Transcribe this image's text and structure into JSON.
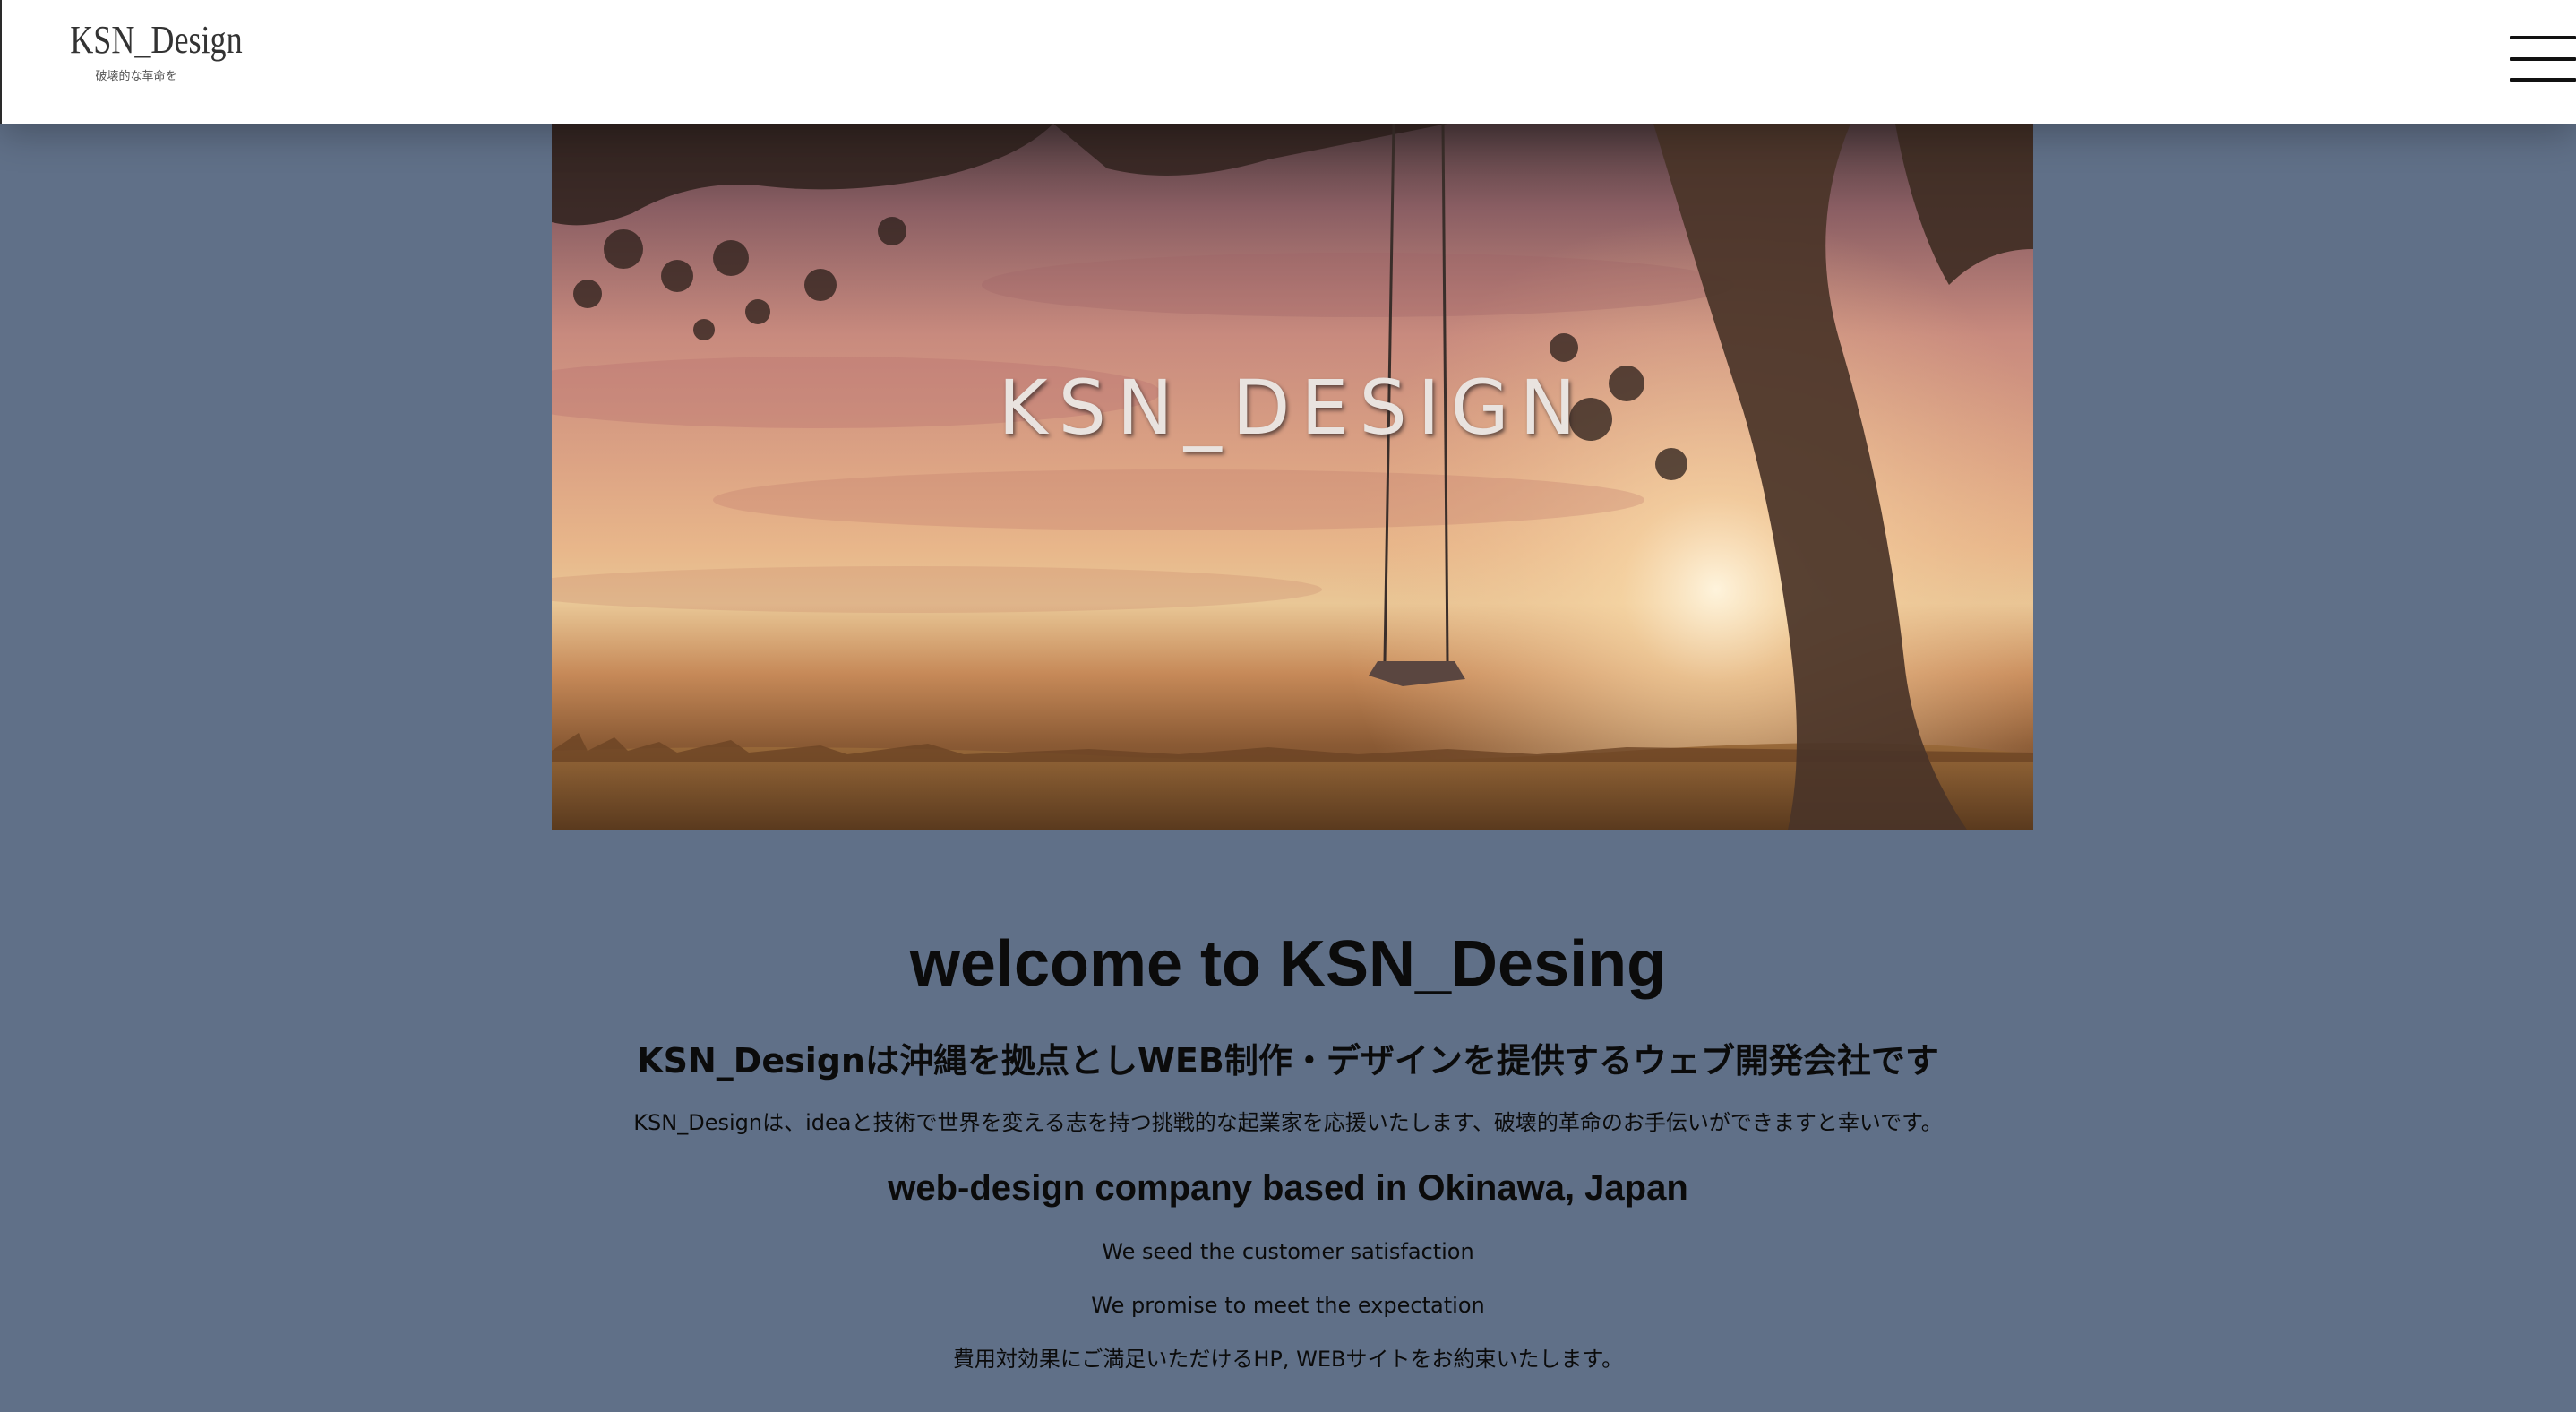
{
  "header": {
    "logo_title": "KSN_Design",
    "logo_tagline": "破壊的な革命を"
  },
  "hero": {
    "title": "KSN_DESIGN"
  },
  "main": {
    "welcome_heading": "welcome to KSN_Desing",
    "subheading_jp": "KSN_Designは沖縄を拠点としWEB制作・デザインを提供するウェブ開発会社です",
    "description_jp": "KSN_Designは、ideaと技術で世界を変える志を持つ挑戦的な起業家を応援いたします、破壊的革命のお手伝いができますと幸いです。",
    "subheading_en": "web-design company based in Okinawa, Japan",
    "line1": "We seed the customer satisfaction",
    "line2": "We promise to meet the expectation",
    "line3": "費用対効果にご満足いただけるHP, WEBサイトをお約束いたします。"
  }
}
